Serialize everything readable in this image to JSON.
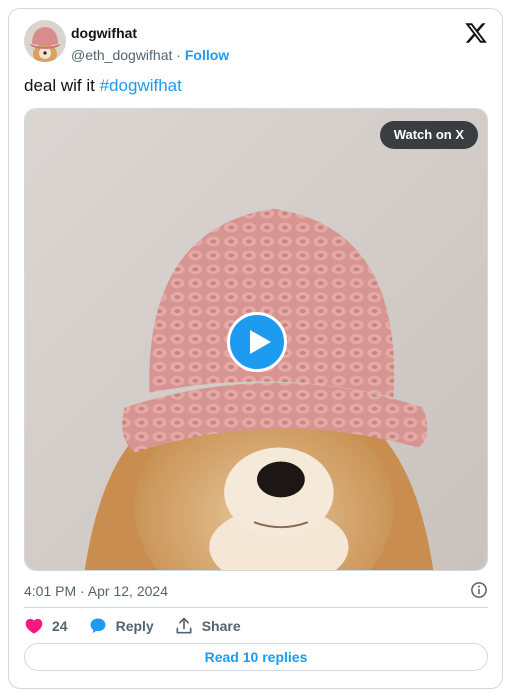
{
  "author": {
    "display_name": "dogwifhat",
    "handle": "@eth_dogwifhat",
    "separator": "·",
    "follow_label": "Follow"
  },
  "tweet": {
    "text": "deal wif it ",
    "hashtag": "#dogwifhat"
  },
  "media": {
    "watch_label": "Watch on X"
  },
  "meta": {
    "timestamp": "4:01 PM · Apr 12, 2024"
  },
  "actions": {
    "like_count": "24",
    "reply_label": "Reply",
    "share_label": "Share"
  },
  "replies_button": "Read 10 replies",
  "colors": {
    "accent": "#1d9bf0",
    "like": "#f91880",
    "muted": "#536471",
    "border": "#cfd9de"
  }
}
